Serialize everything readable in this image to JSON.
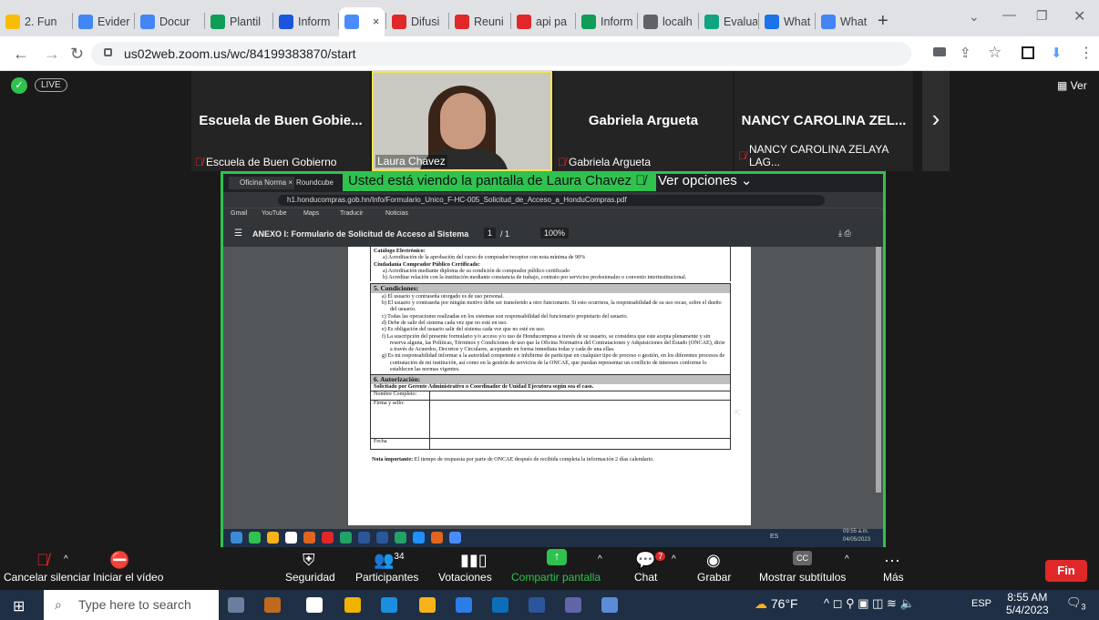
{
  "browser": {
    "tabs": [
      {
        "label": "2. Fun",
        "color": "#fbbc05"
      },
      {
        "label": "Evider",
        "color": "#4285f4"
      },
      {
        "label": "Docur",
        "color": "#4285f4"
      },
      {
        "label": "Plantil",
        "color": "#0f9d58"
      },
      {
        "label": "Inform",
        "color": "#1a56db"
      },
      {
        "label": "",
        "color": "#4a8cff",
        "close": "×"
      },
      {
        "label": "Difusi",
        "color": "#e02828"
      },
      {
        "label": "Reuni",
        "color": "#e02828"
      },
      {
        "label": "api pa",
        "color": "#e02828"
      },
      {
        "label": "Inform",
        "color": "#0f9d58"
      },
      {
        "label": "localh",
        "color": "#5f6368"
      },
      {
        "label": "Evalua",
        "color": "#10a37f"
      },
      {
        "label": "What",
        "color": "#1a73e8"
      },
      {
        "label": "What",
        "color": "#4285f4"
      }
    ],
    "new_tab": "+",
    "url": "us02web.zoom.us/wc/84199383870/start"
  },
  "zoom": {
    "live": "LIVE",
    "view": "Ver",
    "participants": [
      {
        "name": "Escuela de Buen Gobie...",
        "label": "Escuela de Buen Gobierno"
      },
      {
        "name": "Gabriela Argueta",
        "label": "Gabriela Argueta"
      },
      {
        "name": "NANCY CAROLINA ZEL...",
        "label": "NANCY CAROLINA ZELAYA LAG..."
      }
    ],
    "speaker": "Laura Chavez",
    "next": "›",
    "banner": "Usted está viendo la pantalla de Laura Chavez",
    "options": "Ver opciones"
  },
  "shared": {
    "tabs": [
      "Oficina Norma",
      "Roundcube"
    ],
    "url": "h1.honducompras.gob.hn/Info/Formulario_Unico_F-HC-005_Solicitud_de_Acceso_a_HonduCompras.pdf",
    "bookmarks": [
      "Gmail",
      "YouTube",
      "Maps",
      "Traducir",
      "Noticias"
    ],
    "pdf_title": "ANEXO I: Formulario de Solicitud de Acceso al Sistema",
    "page": "1",
    "pages": "/ 1",
    "zoom": "100%",
    "doc": {
      "cat": "Catálogo Electrónico:",
      "cat_a": "a)   Acreditación de la aprobación del curso de comprador/receptor con nota mínima de 90%",
      "cert": "Ciudadanía Comprador Público Certificado:",
      "cert_a": "a)   Acreditación mediante diploma de su condición de comprador público certificado",
      "cert_b": "b)   Acreditar relación con la institución mediante constancia de trabajo, contrato por servicios profesionales o convenio interinstitucional.",
      "s5": "5.  Condiciones:",
      "conds": [
        "a)   El usuario y contraseña otorgado es de uso personal.",
        "b)   El usuario y contraseña por ningún motivo debe ser transferido a otro funcionario. Si esto ocurriera, la responsabilidad de su uso recae, sobre el dueño del usuario.",
        "c)   Todas las operaciones realizadas en los sistemas son responsabilidad del funcionario propietario del usuario.",
        "d)   Debe de salir del sistema cada vez que no esté en uso.",
        "e)   Es obligación del usuario salir del sistema cada vez que no esté en uso.",
        "f)   La suscripción del presente formulario y/o acceso y/o uso de Honducompras a través de su usuario, se considera que este acepta plenamente y sin reserva alguna, las Políticas, Términos y Condiciones de uso que la Oficina Normativa del Contrataciones y Adquisiciones del Estado (ONCAE), dicte a través de Acuerdos, Decretos y Circulares, aceptando en forma inmediata todas y cada de una ellas.",
        "g)   Es mi responsabilidad informar a la autoridad competente e inhibirme de participar en cualquier tipo de proceso o gestión, en los diferentes procesos de contratación de mi institución, así como en la gestión de servicios de la ONCAE, que puedan representar un conflicto de intereses conforme lo establecen las normas vigentes."
      ],
      "s6": "6. Autorización:",
      "s6_sub": "Solicitado por Gerente Administrativo o Coordinador de Unidad Ejecutora según sea el caso.",
      "rows": [
        "Nombre Completo:",
        "Firma y sello:",
        "Fecha"
      ],
      "note_b": "Nota importante:",
      "note": " El tiempo de respuesta por parte de ONCAE después de recibida completa la información 2 días calendario."
    },
    "tray_lang": "ES",
    "tray_time": "09:55 a.m.",
    "tray_date": "04/05/2023"
  },
  "toolbar": [
    {
      "label": "Cancelar silenciar",
      "icon": "mic-muted"
    },
    {
      "label": "Iniciar el vídeo",
      "icon": "video-off"
    },
    {
      "label": "Seguridad",
      "icon": "shield"
    },
    {
      "label": "Participantes",
      "icon": "people",
      "badge": "34"
    },
    {
      "label": "Votaciones",
      "icon": "poll"
    },
    {
      "label": "Compartir pantalla",
      "icon": "share"
    },
    {
      "label": "Chat",
      "icon": "chat",
      "badge": "7"
    },
    {
      "label": "Grabar",
      "icon": "record"
    },
    {
      "label": "Mostrar subtítulos",
      "icon": "cc"
    },
    {
      "label": "Más",
      "icon": "more"
    }
  ],
  "end": "Fin",
  "taskbar": {
    "search": "Type here to search",
    "weather": "76°F",
    "lang": "ESP",
    "time": "8:55 AM",
    "date": "5/4/2023",
    "notif": "3"
  }
}
